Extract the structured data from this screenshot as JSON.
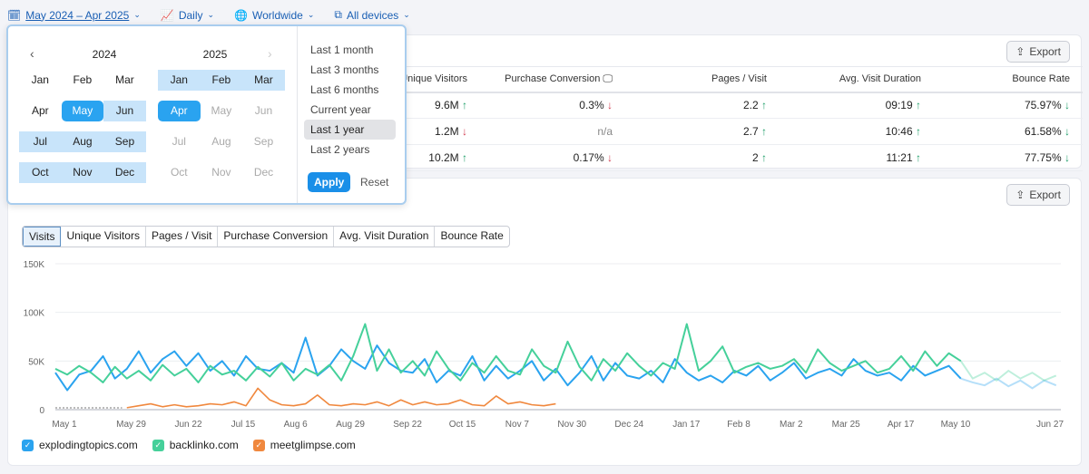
{
  "topbar": {
    "date_range": "May 2024 – Apr 2025",
    "granularity": "Daily",
    "region": "Worldwide",
    "devices": "All devices"
  },
  "datepicker": {
    "left_year": "2024",
    "right_year": "2025",
    "months": [
      "Jan",
      "Feb",
      "Mar",
      "Apr",
      "May",
      "Jun",
      "Jul",
      "Aug",
      "Sep",
      "Oct",
      "Nov",
      "Dec"
    ],
    "left_states": [
      "",
      "",
      "",
      "",
      "selected",
      "range",
      "range",
      "range",
      "range",
      "range",
      "range",
      "range"
    ],
    "right_states": [
      "range",
      "range",
      "range",
      "selected",
      "disabled",
      "disabled",
      "disabled",
      "disabled",
      "disabled",
      "disabled",
      "disabled",
      "disabled"
    ],
    "presets": [
      "Last 1 month",
      "Last 3 months",
      "Last 6 months",
      "Current year",
      "Last 1 year",
      "Last 2 years"
    ],
    "active_preset": "Last 1 year",
    "apply": "Apply",
    "reset": "Reset"
  },
  "table": {
    "export": "Export",
    "headers": [
      "Unique Visitors",
      "Purchase Conversion",
      "Pages / Visit",
      "Avg. Visit Duration",
      "Bounce Rate"
    ],
    "rows": [
      [
        [
          "9.6M",
          "up"
        ],
        [
          "0.3%",
          "down-bad"
        ],
        [
          "2.2",
          "up"
        ],
        [
          "09:19",
          "up"
        ],
        [
          "75.97%",
          "down-good"
        ]
      ],
      [
        [
          "1.2M",
          "down-bad"
        ],
        [
          "n/a",
          ""
        ],
        [
          "2.7",
          "up"
        ],
        [
          "10:46",
          "up"
        ],
        [
          "61.58%",
          "down-good"
        ]
      ],
      [
        [
          "10.2M",
          "up"
        ],
        [
          "0.17%",
          "down-bad"
        ],
        [
          "2",
          "up"
        ],
        [
          "11:21",
          "up"
        ],
        [
          "77.75%",
          "down-good"
        ]
      ]
    ]
  },
  "chart_card": {
    "export": "Export",
    "tabs": [
      "Visits",
      "Unique Visitors",
      "Pages / Visit",
      "Purchase Conversion",
      "Avg. Visit Duration",
      "Bounce Rate"
    ],
    "active_tab": "Visits"
  },
  "chart_data": {
    "type": "line",
    "y_ticks": [
      "0",
      "50K",
      "100K",
      "150K"
    ],
    "ylim": [
      0,
      150000
    ],
    "x_ticks": [
      "May 1",
      "May 29",
      "Jun 22",
      "Jul 15",
      "Aug 6",
      "Aug 29",
      "Sep 22",
      "Oct 15",
      "Nov 7",
      "Nov 30",
      "Dec 24",
      "Jan 17",
      "Feb 8",
      "Mar 2",
      "Mar 25",
      "Apr 17",
      "May 10",
      "Jun 27"
    ],
    "grid": true,
    "legend": "bottom-left",
    "series": [
      {
        "name": "explodingtopics.com",
        "color": "#2aa3ef",
        "unit": "K",
        "values": [
          38,
          20,
          36,
          40,
          55,
          32,
          42,
          60,
          38,
          52,
          60,
          45,
          58,
          40,
          50,
          35,
          55,
          42,
          40,
          48,
          38,
          74,
          35,
          45,
          62,
          50,
          42,
          66,
          48,
          40,
          38,
          52,
          28,
          40,
          35,
          55,
          30,
          45,
          32,
          40,
          50,
          30,
          42,
          25,
          38,
          55,
          30,
          48,
          35,
          32,
          40,
          28,
          52,
          38,
          30,
          35,
          28,
          40,
          35,
          45,
          30,
          38,
          48,
          32,
          38,
          42,
          35,
          52,
          40,
          35,
          38,
          30,
          45,
          35,
          40,
          45,
          32
        ],
        "forecast": [
          28,
          25,
          32,
          24,
          30,
          22,
          30,
          25
        ]
      },
      {
        "name": "backlinko.com",
        "color": "#45d09a",
        "unit": "K",
        "values": [
          42,
          36,
          45,
          38,
          28,
          44,
          32,
          40,
          30,
          46,
          35,
          42,
          28,
          45,
          36,
          40,
          30,
          44,
          34,
          48,
          30,
          42,
          36,
          46,
          30,
          55,
          88,
          40,
          62,
          38,
          50,
          35,
          60,
          42,
          30,
          48,
          38,
          55,
          40,
          36,
          62,
          45,
          38,
          70,
          44,
          30,
          52,
          40,
          58,
          45,
          35,
          48,
          42,
          88,
          40,
          50,
          65,
          38,
          44,
          48,
          42,
          45,
          52,
          38,
          62,
          48,
          40,
          45,
          50,
          38,
          42,
          55,
          40,
          60,
          45,
          58,
          50
        ],
        "forecast": [
          32,
          38,
          30,
          40,
          32,
          38,
          30,
          35
        ]
      },
      {
        "name": "meetglimpse.com",
        "color": "#f0883e",
        "unit": "K",
        "values": [
          2,
          4,
          6,
          3,
          5,
          3,
          4,
          6,
          5,
          8,
          4,
          22,
          10,
          5,
          4,
          6,
          15,
          5,
          4,
          6,
          5,
          8,
          4,
          10,
          5,
          8,
          5,
          6,
          10,
          5,
          4,
          14,
          6,
          8,
          5,
          4,
          6
        ]
      }
    ]
  }
}
